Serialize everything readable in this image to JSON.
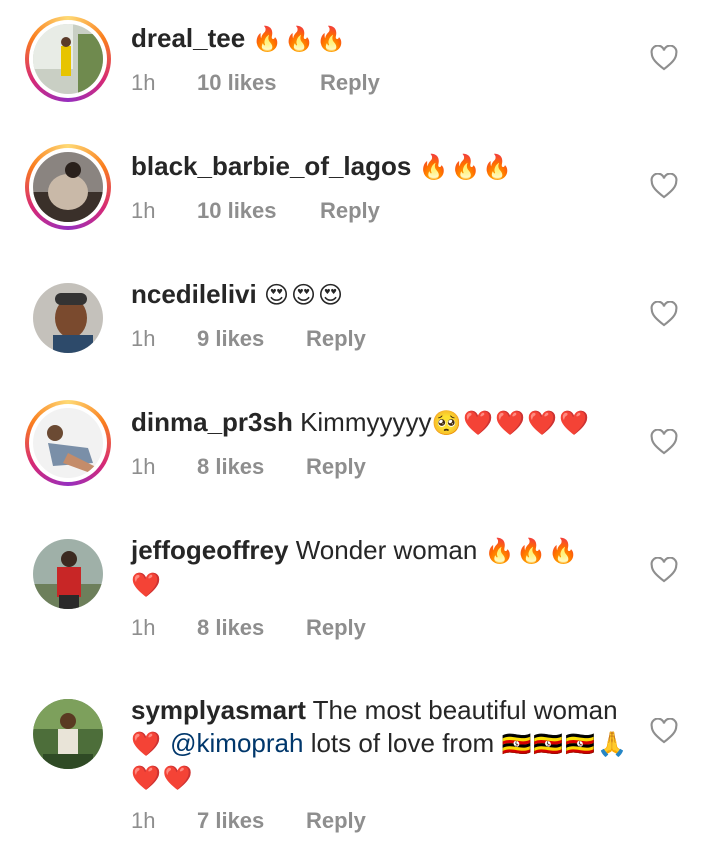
{
  "comments": [
    {
      "username": "dreal_tee",
      "text": "",
      "emoji": "🔥🔥🔥",
      "time": "1h",
      "likes": "10 likes",
      "reply": "Reply"
    },
    {
      "username": "black_barbie_of_lagos",
      "text": "",
      "emoji": "🔥🔥🔥",
      "time": "1h",
      "likes": "10 likes",
      "reply": "Reply"
    },
    {
      "username": "ncedilelivi",
      "text": "",
      "emoji": "😍😍😍",
      "time": "1h",
      "likes": "9 likes",
      "reply": "Reply"
    },
    {
      "username": "dinma_pr3sh",
      "text": "Kimmyyyyy",
      "emoji": "🥺❤️❤️❤️❤️",
      "time": "1h",
      "likes": "8 likes",
      "reply": "Reply"
    },
    {
      "username": "jeffogeoffrey",
      "text": "Wonder woman",
      "emoji": "🔥🔥🔥",
      "emoji2": "❤️",
      "time": "1h",
      "likes": "8 likes",
      "reply": "Reply"
    },
    {
      "username": "symplyasmart",
      "text": "The most beautiful woman",
      "emoji": "❤️",
      "mention": "@kimoprah",
      "text2": "lots of love from",
      "emoji2": "🇺🇬🇺🇬🇺🇬🙏 ❤️❤️",
      "time": "1h",
      "likes": "7 likes",
      "reply": "Reply"
    }
  ],
  "icons": {
    "like": "heart-outline-icon"
  },
  "colors": {
    "username": "#262626",
    "meta": "#8e8e8e",
    "mention": "#00376b"
  }
}
